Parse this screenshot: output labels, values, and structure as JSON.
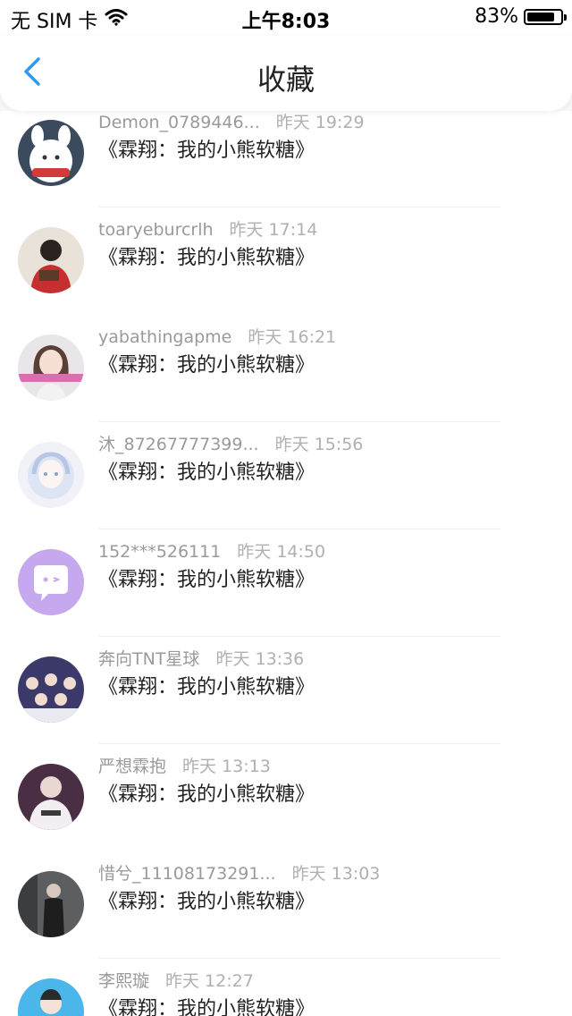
{
  "status_bar": {
    "carrier": "无 SIM 卡",
    "time": "上午8:03",
    "battery": "83%",
    "battery_level": 0.83
  },
  "nav": {
    "title": "收藏",
    "back_icon": "chevron-left-icon",
    "accent": "#2e9bf0"
  },
  "items": [
    {
      "user": "Demon_0789446...",
      "time": "昨天 19:29",
      "title": "《霖翔：我的小熊软糖》"
    },
    {
      "user": "toaryeburcrlh",
      "time": "昨天 17:14",
      "title": "《霖翔：我的小熊软糖》"
    },
    {
      "user": "yabathingapme",
      "time": "昨天 16:21",
      "title": "《霖翔：我的小熊软糖》"
    },
    {
      "user": "沐_87267777399...",
      "time": "昨天 15:56",
      "title": "《霖翔：我的小熊软糖》"
    },
    {
      "user": "152***526111",
      "time": "昨天 14:50",
      "title": "《霖翔：我的小熊软糖》"
    },
    {
      "user": "奔向TNT星球",
      "time": "昨天 13:36",
      "title": "《霖翔：我的小熊软糖》"
    },
    {
      "user": "严想霖抱",
      "time": "昨天 13:13",
      "title": "《霖翔：我的小熊软糖》"
    },
    {
      "user": "惜兮_11108173291...",
      "time": "昨天 13:03",
      "title": "《霖翔：我的小熊软糖》"
    },
    {
      "user": "李熙璇",
      "time": "昨天 12:27",
      "title": "《霖翔：我的小熊软糖》"
    }
  ]
}
